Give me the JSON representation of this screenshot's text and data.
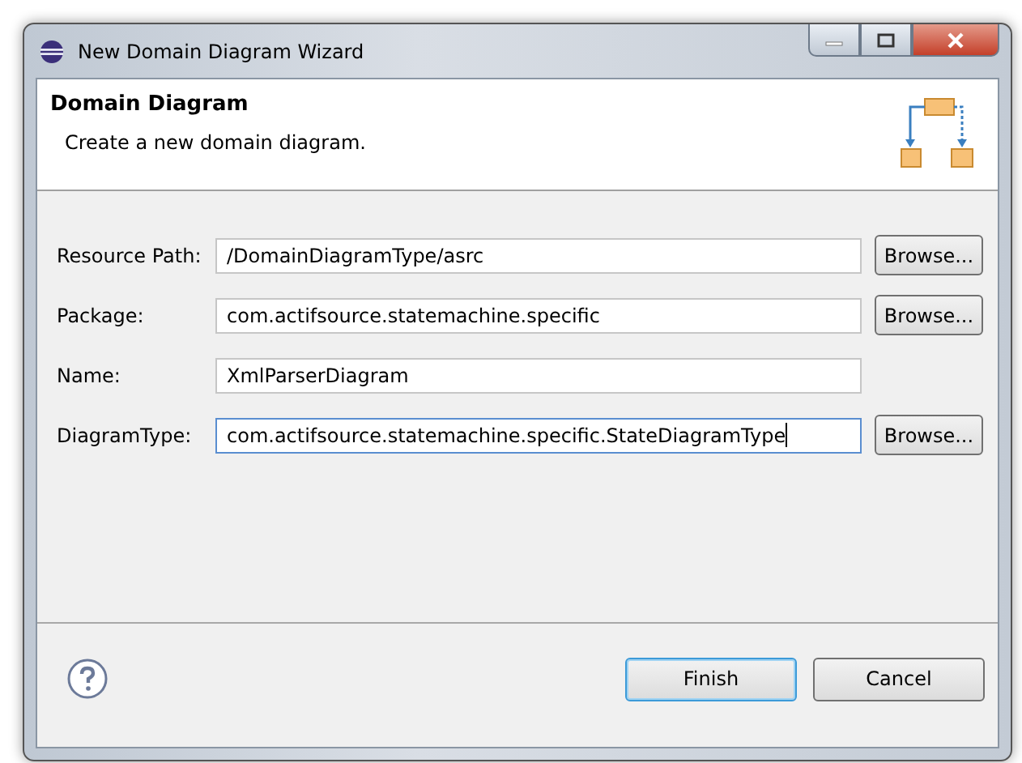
{
  "window": {
    "title": "New Domain Diagram Wizard"
  },
  "header": {
    "title": "Domain Diagram",
    "description": "Create a new domain diagram."
  },
  "fields": [
    {
      "label": "Resource Path:",
      "value": "/DomainDiagramType/asrc",
      "focused": false,
      "browse": "Browse..."
    },
    {
      "label": "Package:",
      "value": "com.actifsource.statemachine.specific",
      "focused": false,
      "browse": "Browse..."
    },
    {
      "label": "Name:",
      "value": "XmlParserDiagram",
      "focused": false
    },
    {
      "label": "DiagramType:",
      "value": "com.actifsource.statemachine.specific.StateDiagramType",
      "focused": true,
      "browse": "Browse..."
    }
  ],
  "buttons": [
    {
      "label": "Finish",
      "default": true
    },
    {
      "label": "Cancel",
      "default": false
    }
  ]
}
